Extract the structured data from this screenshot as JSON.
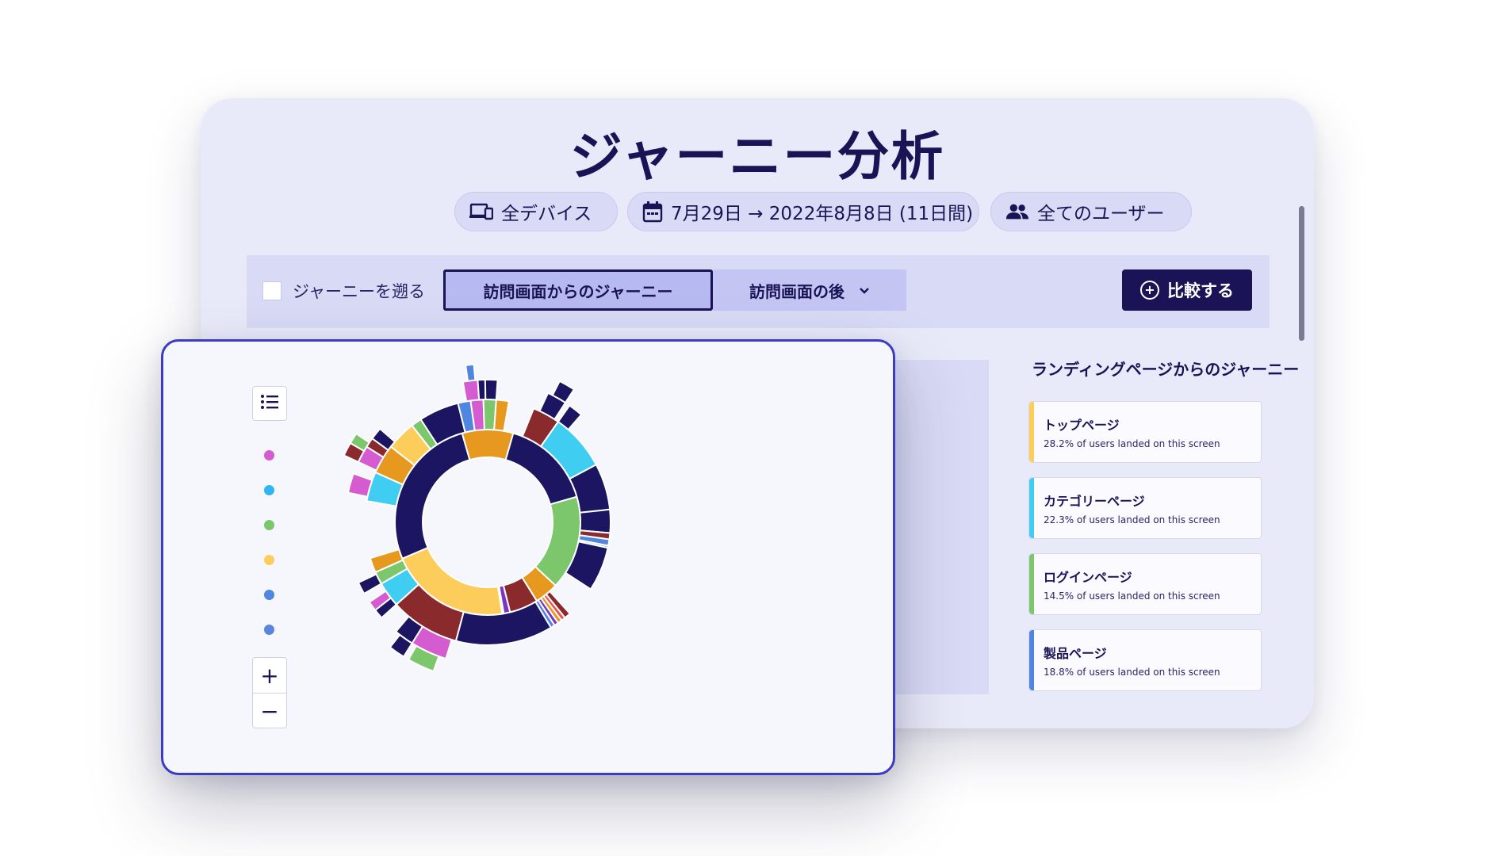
{
  "title": "ジャーニー分析",
  "filters": {
    "devices": "全デバイス",
    "dates": "7月29日 → 2022年8月8日 (11日間)",
    "users": "全てのユーザー"
  },
  "toolbar": {
    "trace_back_label": "ジャーニーを遡る",
    "trace_back_checked": false,
    "segment_from": "訪問画面からのジャーニー",
    "segment_after": "訪問画面の後",
    "compare_label": "比較する"
  },
  "side_panel": {
    "title": "ランディングページからのジャーニー",
    "cards": [
      {
        "name": "トップページ",
        "desc": "28.2% of users landed on this screen",
        "share_pct": 28.2,
        "color": "#fdcd5b"
      },
      {
        "name": "カテゴリーページ",
        "desc": "22.3% of users landed on this screen",
        "share_pct": 22.3,
        "color": "#40cdf2"
      },
      {
        "name": "ログインページ",
        "desc": "14.5% of users landed on this screen",
        "share_pct": 14.5,
        "color": "#7cc66b"
      },
      {
        "name": "製品ページ",
        "desc": "18.8% of users landed on this screen",
        "share_pct": 18.8,
        "color": "#4e86e0"
      }
    ]
  },
  "legend_colors": [
    "#d45cd0",
    "#2fb5ef",
    "#7cc66b",
    "#fdcd5b",
    "#4e86e0",
    "#5b84db"
  ],
  "icons": {
    "devices": "devices-icon",
    "calendar": "calendar-icon",
    "users": "users-icon",
    "list": "list-icon",
    "compare": "plus-circle-icon",
    "zoom_in": "plus-icon",
    "zoom_out": "minus-icon",
    "dropdown": "chevron-down-icon"
  },
  "zoom": {
    "in": "+",
    "out": "−"
  },
  "chart_data": {
    "type": "sunburst",
    "palette": {
      "navy": "#1c1662",
      "yellow": "#fdcd5b",
      "orange": "#e6981f",
      "green": "#7cc66b",
      "cyan": "#40cdf2",
      "maroon": "#8a2a2c",
      "magenta": "#d45cd0",
      "blue": "#4e86e0",
      "purple": "#7d34c2",
      "red": "#ef5350"
    },
    "rings": [
      [
        {
          "from": 16,
          "to": 74,
          "color": "navy"
        },
        {
          "from": 74,
          "to": 133,
          "color": "green"
        },
        {
          "from": 133,
          "to": 148,
          "color": "orange"
        },
        {
          "from": 148,
          "to": 166,
          "color": "maroon"
        },
        {
          "from": 166,
          "to": 170,
          "color": "purple"
        },
        {
          "from": 170,
          "to": 171,
          "color": "red"
        },
        {
          "from": 171,
          "to": 247,
          "color": "yellow"
        },
        {
          "from": 247,
          "to": 344,
          "color": "navy"
        },
        {
          "from": 344,
          "to": 376,
          "color": "orange"
        }
      ],
      [
        {
          "from": 22,
          "to": 35,
          "color": "maroon"
        },
        {
          "from": 35,
          "to": 62,
          "color": "cyan"
        },
        {
          "from": 62,
          "to": 84,
          "color": "navy"
        },
        {
          "from": 84,
          "to": 95,
          "color": "navy"
        },
        {
          "from": 95,
          "to": 98,
          "color": "maroon"
        },
        {
          "from": 98,
          "to": 101,
          "color": "blue"
        },
        {
          "from": 101,
          "to": 102,
          "color": "green"
        },
        {
          "from": 102,
          "to": 123,
          "color": "navy"
        },
        {
          "from": 138,
          "to": 141,
          "color": "maroon"
        },
        {
          "from": 141,
          "to": 143,
          "color": "red"
        },
        {
          "from": 143,
          "to": 145,
          "color": "orange"
        },
        {
          "from": 145,
          "to": 147,
          "color": "purple"
        },
        {
          "from": 147,
          "to": 149,
          "color": "blue"
        },
        {
          "from": 149,
          "to": 195,
          "color": "navy"
        },
        {
          "from": 195,
          "to": 228,
          "color": "maroon"
        },
        {
          "from": 228,
          "to": 240,
          "color": "cyan"
        },
        {
          "from": 240,
          "to": 246,
          "color": "green"
        },
        {
          "from": 246,
          "to": 253,
          "color": "orange"
        },
        {
          "from": 280,
          "to": 294,
          "color": "cyan"
        },
        {
          "from": 294,
          "to": 308,
          "color": "orange"
        },
        {
          "from": 308,
          "to": 322,
          "color": "yellow"
        },
        {
          "from": 322,
          "to": 327,
          "color": "green"
        },
        {
          "from": 327,
          "to": 346,
          "color": "navy"
        },
        {
          "from": 346,
          "to": 352,
          "color": "blue"
        },
        {
          "from": 352,
          "to": 358,
          "color": "magenta"
        },
        {
          "from": 358,
          "to": 364,
          "color": "green"
        },
        {
          "from": 364,
          "to": 370,
          "color": "orange"
        }
      ],
      [
        {
          "from": 25,
          "to": 33,
          "color": "navy"
        },
        {
          "from": 35,
          "to": 41,
          "color": "navy"
        },
        {
          "from": 197,
          "to": 212,
          "color": "magenta"
        },
        {
          "from": 212,
          "to": 220,
          "color": "navy"
        },
        {
          "from": 228,
          "to": 232,
          "color": "navy"
        },
        {
          "from": 232,
          "to": 236,
          "color": "magenta"
        },
        {
          "from": 240,
          "to": 245,
          "color": "navy"
        },
        {
          "from": 282,
          "to": 290,
          "color": "magenta"
        },
        {
          "from": 295,
          "to": 302,
          "color": "magenta"
        },
        {
          "from": 302,
          "to": 306,
          "color": "maroon"
        },
        {
          "from": 306,
          "to": 311,
          "color": "navy"
        },
        {
          "from": 350,
          "to": 356,
          "color": "magenta"
        },
        {
          "from": 356,
          "to": 359,
          "color": "navy"
        },
        {
          "from": 359,
          "to": 364,
          "color": "navy"
        }
      ],
      [
        {
          "from": 27,
          "to": 33,
          "color": "navy"
        },
        {
          "from": 200,
          "to": 210,
          "color": "green"
        },
        {
          "from": 212,
          "to": 218,
          "color": "navy"
        },
        {
          "from": 295,
          "to": 300,
          "color": "maroon"
        },
        {
          "from": 300,
          "to": 304,
          "color": "green"
        },
        {
          "from": 352,
          "to": 355,
          "color": "blue"
        }
      ]
    ]
  }
}
